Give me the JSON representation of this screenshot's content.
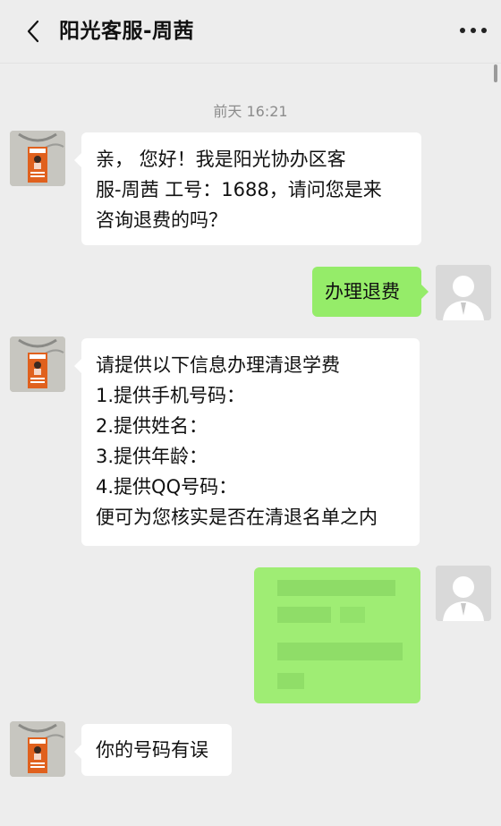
{
  "header": {
    "title": "阳光客服-周茜",
    "back_icon": "chevron-left-icon",
    "more_icon": "more-dots-icon"
  },
  "colors": {
    "background": "#ededed",
    "incoming_bubble": "#ffffff",
    "outgoing_bubble": "#95ec69",
    "timestamp_text": "#8c8c8c"
  },
  "messages": [
    {
      "type": "timestamp",
      "text": "前天 16:21"
    },
    {
      "from": "agent",
      "lines": [
        "亲， 您好！我是阳光协办区客",
        "服-周茜 工号：1688，请问您是来",
        "咨询退费的吗？"
      ]
    },
    {
      "from": "user",
      "lines": [
        "办理退费"
      ]
    },
    {
      "from": "agent",
      "lines": [
        "请提供以下信息办理清退学费",
        "1.提供手机号码：",
        "2.提供姓名：",
        "3.提供年龄：",
        "4.提供QQ号码：",
        "便可为您核实是否在清退名单之内"
      ]
    },
    {
      "from": "user",
      "content": "pixelated-redacted"
    },
    {
      "from": "agent",
      "lines": [
        "你的号码有误"
      ]
    }
  ]
}
